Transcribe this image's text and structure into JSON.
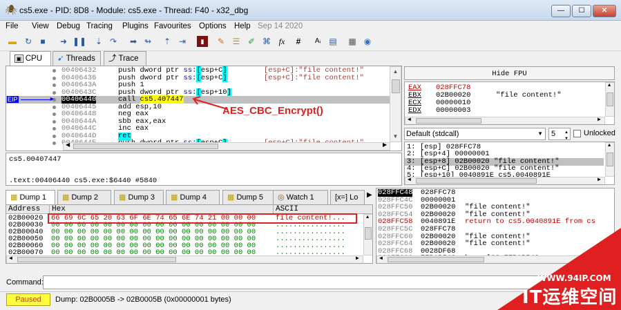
{
  "window": {
    "title": "cs5.exe - PID: 8D8 - Module: cs5.exe - Thread: F40 - x32_dbg",
    "btn_min": "—",
    "btn_max": "☐",
    "btn_close": "✕"
  },
  "menu": [
    "File",
    "View",
    "Debug",
    "Tracing",
    "Plugins",
    "Favourites",
    "Options",
    "Help",
    "Sep 14 2020"
  ],
  "toolbar_icons": [
    "open-icon",
    "restart-icon",
    "stop-icon",
    "run-icon",
    "pause-icon",
    "step-into-icon",
    "step-over-icon",
    "trace-into-icon",
    "trace-over-icon",
    "execute-till-return-icon",
    "run-to-user-code-icon",
    "scylla-icon",
    "patch-icon",
    "comment-icon",
    "label-icon",
    "bookmark-icon",
    "function-icon",
    "hash-icon",
    "font-icon",
    "preferences-icon",
    "calculator-icon",
    "about-icon"
  ],
  "toolbar_glyphs": {
    "fx": "fx",
    "hash": "#",
    "font": "Aᵢ"
  },
  "tabs": [
    "CPU",
    "Threads",
    "Trace"
  ],
  "disasm": {
    "eip_label": "EIP",
    "rows": [
      {
        "addr": "00406432",
        "instr": "push dword ptr ss:[esp+C]",
        "comment": "[esp+C]:\"file content!\""
      },
      {
        "addr": "00406436",
        "instr": "push dword ptr ss:[esp+C]",
        "comment": "[esp+C]:\"file content!\""
      },
      {
        "addr": "0040643A",
        "instr": "push 1",
        "comment": ""
      },
      {
        "addr": "0040643C",
        "instr": "push dword ptr ss:[esp+10]",
        "comment": ""
      },
      {
        "addr": "00406440",
        "instr": "call cs5.407447",
        "comment": ""
      },
      {
        "addr": "00406445",
        "instr": "add esp,10",
        "comment": ""
      },
      {
        "addr": "00406448",
        "instr": "neg eax",
        "comment": ""
      },
      {
        "addr": "0040644A",
        "instr": "sbb eax,eax",
        "comment": ""
      },
      {
        "addr": "0040644C",
        "instr": "inc eax",
        "comment": ""
      },
      {
        "addr": "0040644D",
        "instr": "ret",
        "comment": ""
      },
      {
        "addr": "0040644E",
        "instr": "push dword ptr ss:[esp+C]",
        "comment": "[esp+C]:\"file content!\""
      }
    ],
    "annotation": "AES_CBC_Encrypt()"
  },
  "info": {
    "line1": "cs5.00407447",
    "line2": ".text:00406440 cs5.exe:$6440 #5840"
  },
  "fpu": {
    "header": "Hide FPU",
    "regs": [
      {
        "name": "EAX",
        "value": "028FFC78",
        "comment": ""
      },
      {
        "name": "EBX",
        "value": "02B00020",
        "comment": "\"file content!\""
      },
      {
        "name": "ECX",
        "value": "00000010",
        "comment": ""
      },
      {
        "name": "EDX",
        "value": "00000003",
        "comment": ""
      }
    ]
  },
  "callconv": {
    "selected": "Default (stdcall)",
    "count": "5",
    "unlocked_label": "Unlocked",
    "args": [
      "1: [esp] 028FFC78",
      "2: [esp+4] 00000001",
      "3: [esp+8] 02B00020 \"file content!\"",
      "4: [esp+C] 02B00020 \"file content!\"",
      "5: [esp+10] 0040891E cs5.0040891E"
    ]
  },
  "dump_tabs": [
    "Dump 1",
    "Dump 2",
    "Dump 3",
    "Dump 4",
    "Dump 5",
    "Watch 1",
    "[x=] Lo"
  ],
  "dump": {
    "col_address": "Address",
    "col_hex": "Hex",
    "col_ascii": "ASCII",
    "rows": [
      {
        "addr": "02B00020",
        "hex": "66 69 6C 65 20 63 6F 6E 74 65 6E 74 21 00 00 00",
        "ascii": "file content!..."
      },
      {
        "addr": "02B00030",
        "hex": "00 00 00 00 00 00 00 00 00 00 00 00 00 00 00 00",
        "ascii": "................"
      },
      {
        "addr": "02B00040",
        "hex": "00 00 00 00 00 00 00 00 00 00 00 00 00 00 00 00",
        "ascii": "................"
      },
      {
        "addr": "02B00050",
        "hex": "00 00 00 00 00 00 00 00 00 00 00 00 00 00 00 00",
        "ascii": "................"
      },
      {
        "addr": "02B00060",
        "hex": "00 00 00 00 00 00 00 00 00 00 00 00 00 00 00 00",
        "ascii": "................"
      },
      {
        "addr": "02B00070",
        "hex": "00 00 00 00 00 00 00 00 00 00 00 00 00 00 00 00",
        "ascii": "................"
      },
      {
        "addr": "02B00080",
        "hex": "00 00 00 00 00 00 00 00 00 00 00 00 00 00 00 00",
        "ascii": "................"
      }
    ]
  },
  "stack": {
    "rows": [
      {
        "addr": "028FFC48",
        "value": "028FFC78",
        "comment": ""
      },
      {
        "addr": "028FFC4C",
        "value": "00000001",
        "comment": ""
      },
      {
        "addr": "028FFC50",
        "value": "02B00020",
        "comment": "\"file content!\""
      },
      {
        "addr": "028FFC54",
        "value": "02B00020",
        "comment": "\"file content!\""
      },
      {
        "addr": "028FFC58",
        "value": "0040891E",
        "comment": "return to cs5.0040891E from cs"
      },
      {
        "addr": "028FFC5C",
        "value": "028FFC78",
        "comment": ""
      },
      {
        "addr": "028FFC60",
        "value": "02B00020",
        "comment": "\"file content!\""
      },
      {
        "addr": "028FFC64",
        "value": "02B00020",
        "comment": "\"file content!\""
      },
      {
        "addr": "028FFC68",
        "value": "0028DF68",
        "comment": ""
      },
      {
        "addr": "028FFC6C",
        "value": "77BAB543",
        "comment": "kernel32.77BAB543"
      }
    ]
  },
  "command": {
    "label": "Command:",
    "value": ""
  },
  "status": {
    "state": "Paused",
    "message": "Dump: 02B0005B -> 02B0005B (0x00000001 bytes)"
  },
  "watermark": {
    "url": "WWW.94IP.COM",
    "text": "IT运维空间"
  },
  "colors": {
    "accent_red": "#e02020",
    "paused_bg": "#ffff40",
    "highlight_yellow": "#ffff00",
    "selected_row": "#c0c0c0",
    "eip_blue": "#0000ff"
  }
}
